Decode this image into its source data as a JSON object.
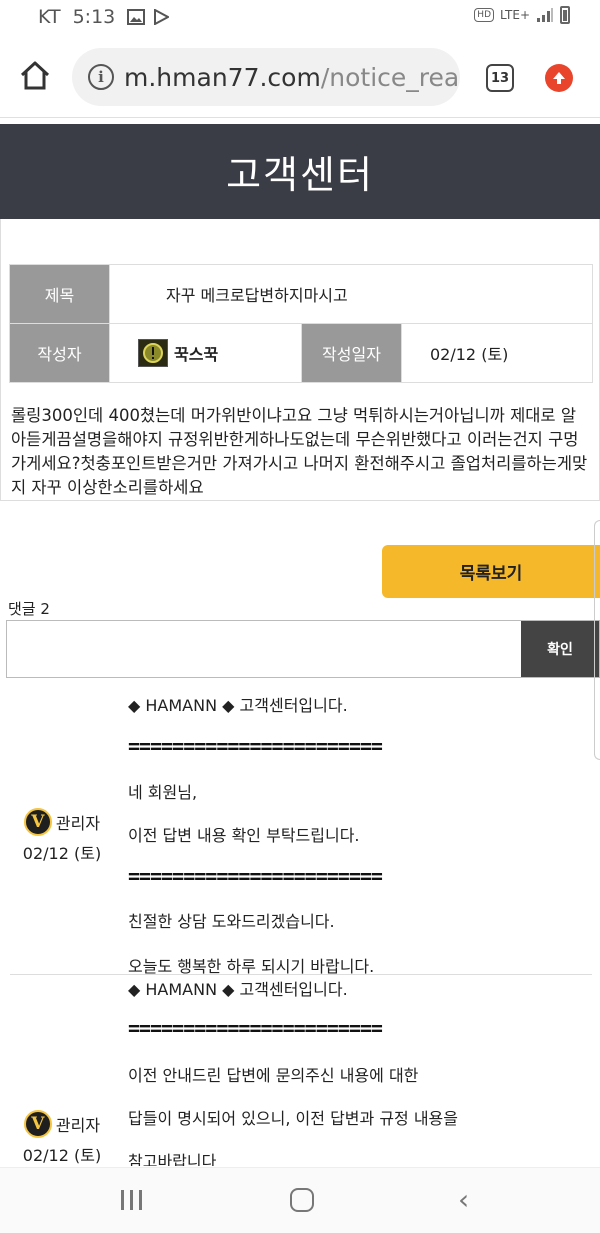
{
  "status_bar": {
    "carrier": "KT",
    "time": "5:13",
    "network": "LTE+",
    "hd": "HD"
  },
  "browser": {
    "url_host": "m.hman77.com",
    "url_path": "/notice_read",
    "tab_count": "13"
  },
  "header": {
    "title": "고객센터"
  },
  "post": {
    "subject_label": "제목",
    "subject": "자꾸 메크로답변하지마시고",
    "author_label": "작성자",
    "author": "꾹스꾹",
    "date_label": "작성일자",
    "date": "02/12 (토)",
    "body": "롤링300인데 400쳤는데 머가위반이냐고요 그냥 먹튀하시는거아닙니까 제대로 알아듣게끔설명을해야지 규정위반한게하나도없는데 무슨위반했다고 이러는건지 구멍가게세요?첫충포인트받은거만 가져가시고 나머지 환전해주시고 졸업처리를하는게맞지 자꾸 이상한소리를하세요"
  },
  "actions": {
    "list_button": "목록보기",
    "comment_count": "댓글 2",
    "comment_placeholder": "",
    "confirm_button": "확인"
  },
  "comments": [
    {
      "badge": "V",
      "author": "관리자",
      "date": "02/12 (토)",
      "lines": [
        "◆ HAMANN ◆ 고객센터입니다.",
        "=======================",
        "네 회원님,",
        "이전 답변 내용 확인 부탁드립니다.",
        "=======================",
        "친절한 상담 도와드리겠습니다.",
        "오늘도 행복한 하루 되시기 바랍니다."
      ]
    },
    {
      "badge": "V",
      "author": "관리자",
      "date": "02/12 (토)",
      "lines": [
        "◆ HAMANN ◆ 고객센터입니다.",
        "=======================",
        "이전 안내드린 답변에 문의주신 내용에 대한",
        "답들이 명시되어 있으니, 이전 답변과 규정 내용을",
        "참고바랍니다"
      ]
    }
  ],
  "colors": {
    "header_bg": "#3a3d45",
    "list_button": "#f5b82a",
    "confirm_button": "#444444",
    "table_header": "#999999",
    "upload_icon": "#e8452c"
  }
}
